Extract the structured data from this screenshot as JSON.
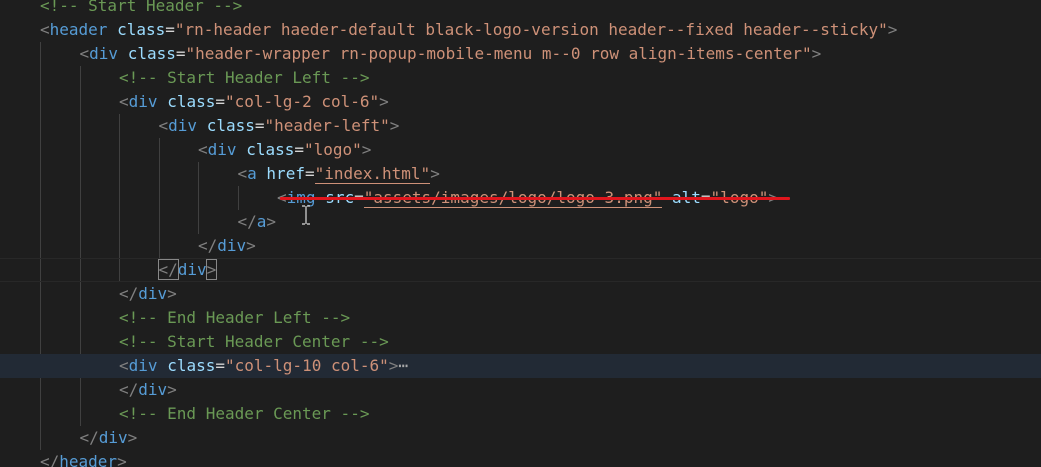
{
  "editor": {
    "language": "html",
    "lines": [
      {
        "indent": 0,
        "parts": [
          [
            "com",
            "<!-- Start Header -->"
          ]
        ]
      },
      {
        "indent": 0,
        "parts": [
          [
            "punc",
            "<"
          ],
          [
            "tag",
            "header"
          ],
          [
            "sp",
            " "
          ],
          [
            "attr",
            "class"
          ],
          [
            "eq",
            "="
          ],
          [
            "str",
            "\"rn-header haeder-default black-logo-version header--fixed header--sticky\""
          ],
          [
            "punc",
            ">"
          ]
        ]
      },
      {
        "indent": 1,
        "parts": [
          [
            "punc",
            "<"
          ],
          [
            "tag",
            "div"
          ],
          [
            "sp",
            " "
          ],
          [
            "attr",
            "class"
          ],
          [
            "eq",
            "="
          ],
          [
            "str",
            "\"header-wrapper rn-popup-mobile-menu m--0 row align-items-center\""
          ],
          [
            "punc",
            ">"
          ]
        ]
      },
      {
        "indent": 2,
        "parts": [
          [
            "com",
            "<!-- Start Header Left -->"
          ]
        ]
      },
      {
        "indent": 2,
        "parts": [
          [
            "punc",
            "<"
          ],
          [
            "tag",
            "div"
          ],
          [
            "sp",
            " "
          ],
          [
            "attr",
            "class"
          ],
          [
            "eq",
            "="
          ],
          [
            "str",
            "\"col-lg-2 col-6\""
          ],
          [
            "punc",
            ">"
          ]
        ]
      },
      {
        "indent": 3,
        "parts": [
          [
            "punc",
            "<"
          ],
          [
            "tag",
            "div"
          ],
          [
            "sp",
            " "
          ],
          [
            "attr",
            "class"
          ],
          [
            "eq",
            "="
          ],
          [
            "str",
            "\"header-left\""
          ],
          [
            "punc",
            ">"
          ]
        ]
      },
      {
        "indent": 4,
        "parts": [
          [
            "punc",
            "<"
          ],
          [
            "tag",
            "div"
          ],
          [
            "sp",
            " "
          ],
          [
            "attr",
            "class"
          ],
          [
            "eq",
            "="
          ],
          [
            "str",
            "\"logo\""
          ],
          [
            "punc",
            ">"
          ]
        ]
      },
      {
        "indent": 5,
        "parts": [
          [
            "punc",
            "<"
          ],
          [
            "tag",
            "a"
          ],
          [
            "sp",
            " "
          ],
          [
            "attr",
            "href"
          ],
          [
            "eq",
            "="
          ],
          [
            "strlink",
            "\"index.html\""
          ],
          [
            "punc",
            ">"
          ]
        ]
      },
      {
        "indent": 6,
        "parts": [
          [
            "punc",
            "<"
          ],
          [
            "tag",
            "img"
          ],
          [
            "sp",
            " "
          ],
          [
            "attr",
            "src"
          ],
          [
            "eq",
            "="
          ],
          [
            "strlink",
            "\"assets/images/logo/logo-3.png\""
          ],
          [
            "sp",
            " "
          ],
          [
            "attr",
            "alt"
          ],
          [
            "eq",
            "="
          ],
          [
            "str",
            "\"logo\""
          ],
          [
            "punc",
            ">"
          ]
        ]
      },
      {
        "indent": 5,
        "parts": [
          [
            "punc",
            "</"
          ],
          [
            "tag",
            "a"
          ],
          [
            "punc",
            ">"
          ]
        ]
      },
      {
        "indent": 4,
        "parts": [
          [
            "punc",
            "</"
          ],
          [
            "tag",
            "div"
          ],
          [
            "punc",
            ">"
          ]
        ]
      },
      {
        "indent": 3,
        "parts": [
          [
            "box",
            "</"
          ],
          [
            "tagbox",
            "div"
          ],
          [
            "box",
            ">"
          ]
        ]
      },
      {
        "indent": 2,
        "parts": [
          [
            "punc",
            "</"
          ],
          [
            "tag",
            "div"
          ],
          [
            "punc",
            ">"
          ]
        ]
      },
      {
        "indent": 2,
        "parts": [
          [
            "com",
            "<!-- End Header Left -->"
          ]
        ]
      },
      {
        "indent": 2,
        "parts": [
          [
            "com",
            "<!-- Start Header Center -->"
          ]
        ]
      },
      {
        "indent": 2,
        "parts": [
          [
            "punc",
            "<"
          ],
          [
            "tag",
            "div"
          ],
          [
            "sp",
            " "
          ],
          [
            "attr",
            "class"
          ],
          [
            "eq",
            "="
          ],
          [
            "str",
            "\"col-lg-10 col-6\""
          ],
          [
            "punc",
            ">"
          ],
          [
            "ell",
            "⋯"
          ]
        ]
      },
      {
        "indent": 2,
        "parts": [
          [
            "punc",
            "</"
          ],
          [
            "tag",
            "div"
          ],
          [
            "punc",
            ">"
          ]
        ]
      },
      {
        "indent": 2,
        "parts": [
          [
            "com",
            "<!-- End Header Center -->"
          ]
        ]
      },
      {
        "indent": 1,
        "parts": [
          [
            "punc",
            "</"
          ],
          [
            "tag",
            "div"
          ],
          [
            "punc",
            ">"
          ]
        ]
      },
      {
        "indent": 0,
        "parts": [
          [
            "punc",
            "</"
          ],
          [
            "tag",
            "header"
          ],
          [
            "punc",
            ">"
          ]
        ]
      }
    ]
  }
}
